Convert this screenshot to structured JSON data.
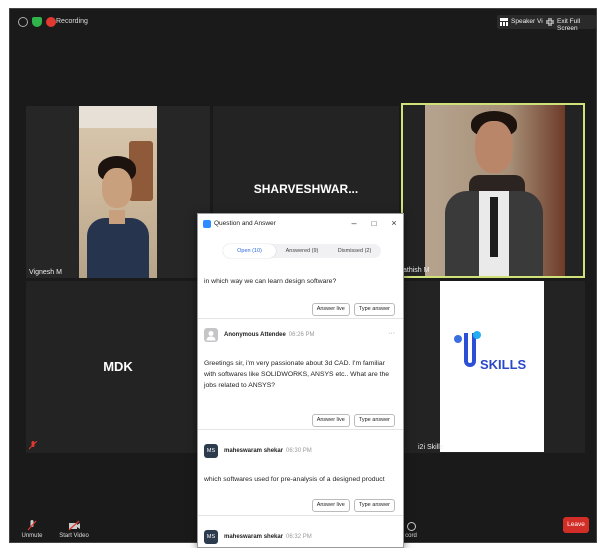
{
  "topbar": {
    "recording_label": "Recording",
    "speaker_view_label": "Speaker View",
    "exit_fullscreen_label": "Exit Full Screen"
  },
  "tiles": {
    "vignesh": "Vignesh M",
    "sharveshwar": "SHARVESHWAR...",
    "sathish": "athish M",
    "mdk": "MDK",
    "skills_logo_text": "SKILLS",
    "skills_name": "i2i Skills"
  },
  "bottombar": {
    "unmute": "Unmute",
    "start_video": "Start Video",
    "record_partial": "cord",
    "leave": "Leave"
  },
  "qa": {
    "window_title": "Question and Answer",
    "tabs": [
      "Open (10)",
      "Answered (9)",
      "Dismissed (2)"
    ],
    "questions": [
      {
        "text": "in which way we can learn design software?",
        "answer_live": "Answer live",
        "type_answer": "Type answer"
      },
      {
        "asker": "Anonymous Attendee",
        "time": "06:26 PM",
        "text": "Greetings sir, i'm very passionate about 3d CAD. I'm familiar with softwares like SOLIDWORKS, ANSYS etc.. What are the jobs related to ANSYS?",
        "answer_live": "Answer live",
        "type_answer": "Type answer"
      },
      {
        "avatar": "MS",
        "asker": "maheswaram shekar",
        "time": "06:30 PM",
        "text": "which softwares used for pre-analysis of a designed product",
        "answer_live": "Answer live",
        "type_answer": "Type answer"
      },
      {
        "avatar": "MS",
        "asker": "maheswaram shekar",
        "time": "06:32 PM"
      }
    ]
  },
  "colors": {
    "accent_blue": "#2d8cff",
    "leave_red": "#d32d27",
    "active_speaker_border": "#cfe27a",
    "avatar_dark": "#2d3b4e"
  }
}
